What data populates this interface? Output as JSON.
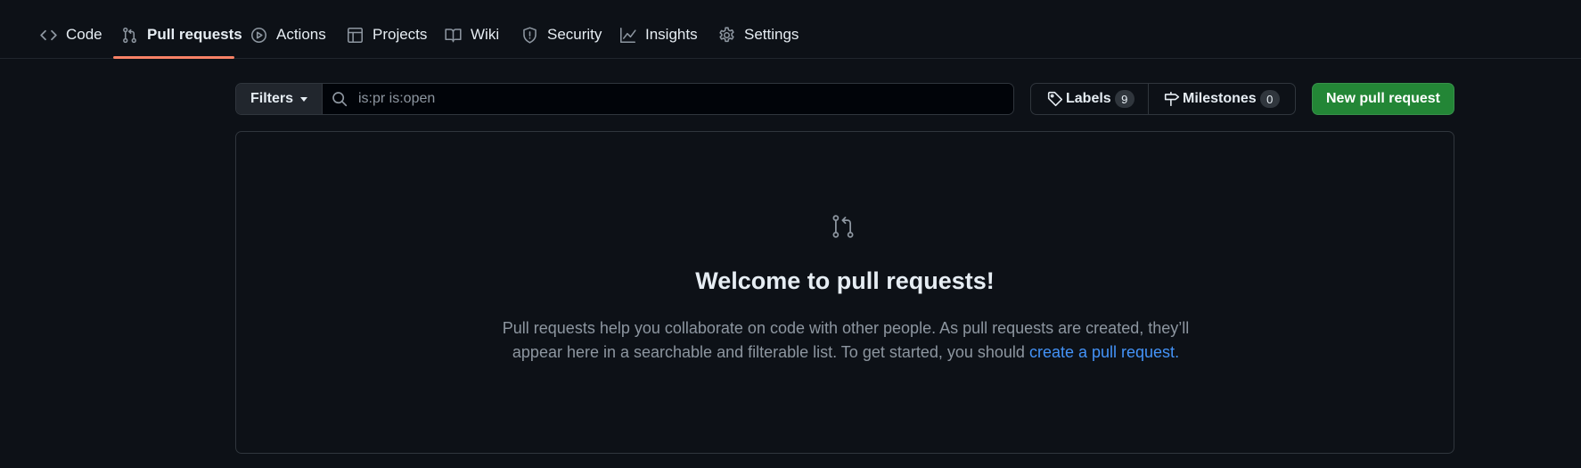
{
  "nav": {
    "tabs": [
      {
        "label": "Code",
        "icon": "code-icon"
      },
      {
        "label": "Pull requests",
        "icon": "git-pull-request-icon",
        "selected": true
      },
      {
        "label": "Actions",
        "icon": "play-icon"
      },
      {
        "label": "Projects",
        "icon": "table-icon"
      },
      {
        "label": "Wiki",
        "icon": "book-icon"
      },
      {
        "label": "Security",
        "icon": "shield-icon"
      },
      {
        "label": "Insights",
        "icon": "graph-icon"
      },
      {
        "label": "Settings",
        "icon": "gear-icon"
      }
    ],
    "selected_underline_color": "#f78166"
  },
  "subnav": {
    "filters_label": "Filters",
    "search_value": "is:pr is:open",
    "labels_label": "Labels",
    "labels_count": "9",
    "milestones_label": "Milestones",
    "milestones_count": "0",
    "new_pr_label": "New pull request",
    "new_pr_color": "#238636"
  },
  "blankslate": {
    "icon": "git-pull-request-icon",
    "title": "Welcome to pull requests!",
    "desc_before": "Pull requests help you collaborate on code with other people. As pull requests are created, they’ll appear here in a searchable and filterable list. To get started, you should ",
    "link_text": "create a pull request",
    "desc_after": ".",
    "link_color": "#4493f8"
  }
}
